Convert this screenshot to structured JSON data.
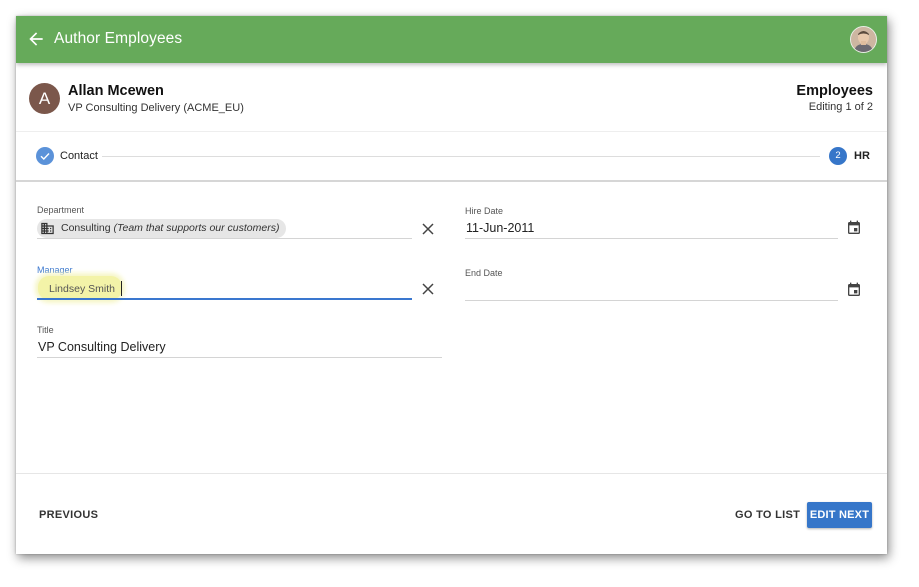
{
  "appbar": {
    "title": "Author Employees",
    "back_icon": "arrow-left-icon",
    "color": "#66aa5a"
  },
  "record": {
    "avatar_letter": "A",
    "name": "Allan Mcewen",
    "subtitle": "VP Consulting Delivery (ACME_EU)",
    "module": "Employees",
    "editing": "Editing 1 of 2"
  },
  "stepper": {
    "steps": [
      {
        "label": "Contact",
        "status": "complete",
        "icon": "check-icon"
      },
      {
        "number": "2",
        "label": "HR",
        "status": "active"
      }
    ]
  },
  "form": {
    "department": {
      "label": "Department",
      "chip_name": "Consulting",
      "chip_desc": "(Team that supports our customers)",
      "icon": "building-icon"
    },
    "manager": {
      "label": "Manager",
      "value": "Lindsey Smith"
    },
    "title": {
      "label": "Title",
      "value": "VP Consulting Delivery"
    },
    "hire_date": {
      "label": "Hire Date",
      "value": "11-Jun-2011",
      "icon": "calendar-icon"
    },
    "end_date": {
      "label": "End Date",
      "value": "",
      "icon": "calendar-icon"
    }
  },
  "footer": {
    "previous": "PREVIOUS",
    "go_to_list": "GO TO LIST",
    "edit_next": "EDIT NEXT",
    "primary_color": "#3676c9"
  }
}
